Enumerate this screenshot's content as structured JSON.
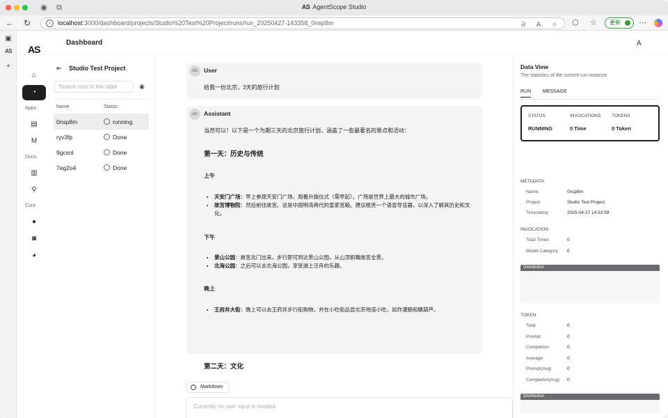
{
  "browser": {
    "window_title": "AgentScope Studio",
    "window_logo": "AS",
    "url_host": "localhost",
    "url_path": ":3000/dashboard/projects/Studio%20Test%20Project/runs/run_20250427-143358_0nsp8m",
    "update_label": "更新"
  },
  "app": {
    "logo": "AS",
    "page_title": "Dashboard",
    "translate_label": "A",
    "rail": {
      "apps_label": "Apps",
      "docs_label": "Docs",
      "cont_label": "Cont",
      "m_label": "M"
    }
  },
  "runs_panel": {
    "project_name": "Studio Test Project",
    "search_placeholder": "Search runs in the table",
    "columns": [
      "Name",
      "Status"
    ],
    "rows": [
      {
        "name": "0nsp8m",
        "status": "running"
      },
      {
        "name": "ryv3fp",
        "status": "Done"
      },
      {
        "name": "9gcsnl",
        "status": "Done"
      },
      {
        "name": "7eg2o4",
        "status": "Done"
      }
    ]
  },
  "chat": {
    "user": {
      "avatar": "Us",
      "name": "User",
      "text": "给我一份北京，3天的旅行计划"
    },
    "assistant": {
      "avatar": "As",
      "name": "Assistant",
      "intro": "当然可以！以下是一个为期三天的北京旅行计划，涵盖了一些最著名的景点和活动：",
      "day1": "第一天：历史与传统",
      "morning": "上午",
      "m_items": [
        {
          "bold": "天安门广场",
          "text": "：早上参观天安门广场，观看升旗仪式（需早起）。广场是世界上最大的城市广场。"
        },
        {
          "bold": "故宫博物院",
          "text": "：然后前往故宫。这是中国明清两代的皇家宫殿。建议租赁一个语音导览器，以深入了解其历史和文化。"
        }
      ],
      "afternoon": "下午",
      "a_items": [
        {
          "bold": "景山公园",
          "text": "：故宫北门出来，步行即可到达景山公园，从山顶俯瞰故宫全景。"
        },
        {
          "bold": "北海公园",
          "text": "：之后可以去北海公园，享受湖上泛舟的乐趣。"
        }
      ],
      "evening": "晚上",
      "e_items": [
        {
          "bold": "王府井大街",
          "text": "：晚上可以去王府井步行街购物，并在小吃街品尝北京地道小吃，如炸灌肠和糖葫芦。"
        }
      ],
      "day2": "第二天：文化"
    },
    "markdown_label": "Markdown",
    "input_placeholder": "Currently no user input is needed"
  },
  "data_view": {
    "title": "Data View",
    "subtitle": "The statistics of the current run instance",
    "tabs": [
      "RUN",
      "MESSAGE"
    ],
    "status_labels": [
      "STATUS",
      "INVOCATIONS",
      "TOKENS"
    ],
    "status_values": [
      "RUNNING",
      "0 Time",
      "0 Token"
    ],
    "metadata_label": "METADATA",
    "metadata": [
      {
        "key": "Name",
        "value": "0nsp8m"
      },
      {
        "key": "Project",
        "value": "Studio Test Project"
      },
      {
        "key": "Timestamp",
        "value": "2025-04-27 14:33:58"
      }
    ],
    "invocation_label": "INVOCATION",
    "invocation": [
      {
        "key": "Total Times",
        "value": "0"
      },
      {
        "key": "Model Category",
        "value": "0"
      }
    ],
    "distribution_label": "Distribution",
    "token_label": "TOKEN",
    "token": [
      {
        "key": "Total",
        "value": "0"
      },
      {
        "key": "Prompt",
        "value": "0"
      },
      {
        "key": "Completion",
        "value": "0"
      },
      {
        "key": "Average",
        "value": "0"
      },
      {
        "key": "Prompt(Avg)",
        "value": "0"
      },
      {
        "key": "Completion(Avg)",
        "value": "0"
      }
    ]
  }
}
